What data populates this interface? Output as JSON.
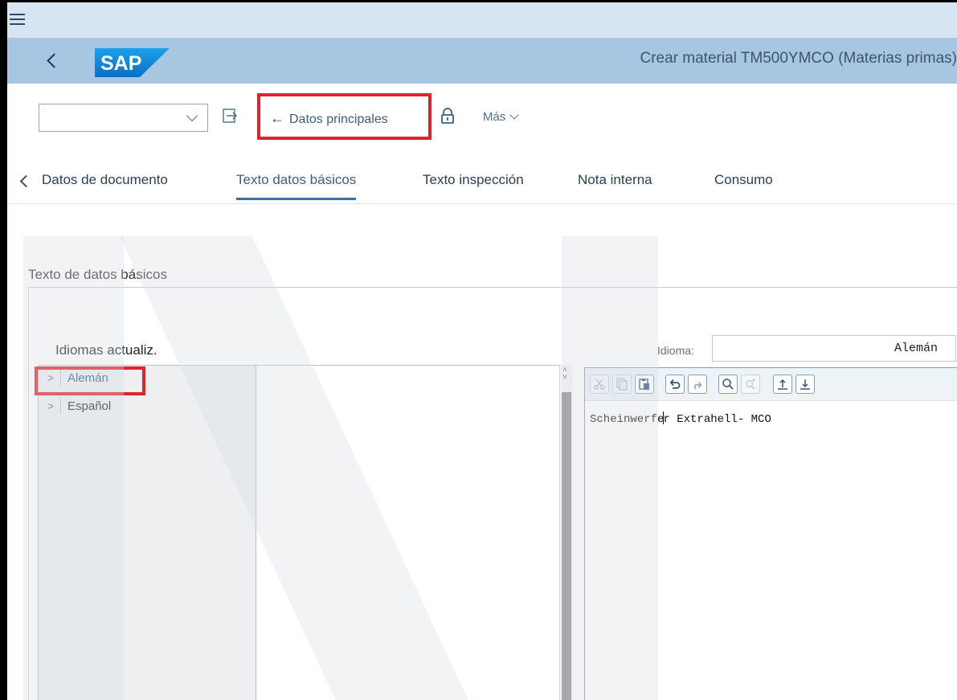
{
  "menu": {
    "menu_icon": "hamburger-menu-icon"
  },
  "shell": {
    "back_icon": "back-chevron-icon",
    "logo_text": "SAP",
    "window_title": "Crear material TM500YMCO (Materias primas)"
  },
  "toolbar": {
    "command_field_value": "",
    "main_data_button_label": "Datos principales",
    "mas_label": "Más",
    "icons": [
      "exit-to-icon",
      "left-arrow-icon",
      "lock-icon",
      "chevron-down-icon"
    ]
  },
  "tabs": [
    {
      "label": "Datos de documento",
      "active": false
    },
    {
      "label": "Texto datos básicos",
      "active": true
    },
    {
      "label": "Texto inspección",
      "active": false
    },
    {
      "label": "Nota interna",
      "active": false
    },
    {
      "label": "Consumo",
      "active": false
    }
  ],
  "section": {
    "title": "Texto de datos básicos",
    "languages_label": "Idiomas actualiz.",
    "idioma_label": "Idioma:",
    "idioma_value": "Alemán"
  },
  "tree": {
    "items": [
      {
        "label": "Alemán",
        "selected": true
      },
      {
        "label": "Español",
        "selected": false
      }
    ]
  },
  "editor": {
    "text_before_cursor": "Scheinwerfe",
    "text_after_cursor": "r Extrahell- MCO",
    "tools": [
      "cut-icon",
      "copy-icon",
      "paste-icon",
      "undo-icon",
      "redo-icon",
      "search-icon",
      "find-next-icon",
      "upload-icon",
      "download-icon"
    ]
  },
  "colors": {
    "highlight_box": "#e0222b",
    "shell_bar": "#a6c6e2",
    "menu_bar": "#d7e5f2",
    "active_tab_underline": "#3d6fa3"
  }
}
